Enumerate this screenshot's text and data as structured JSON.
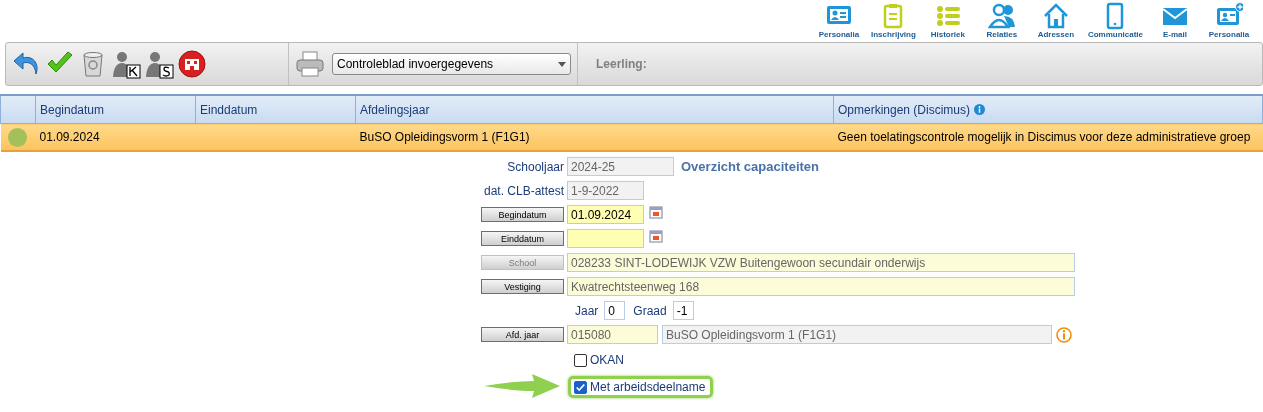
{
  "nav": [
    {
      "label": "Personalia"
    },
    {
      "label": "Inschrijving"
    },
    {
      "label": "Historiek"
    },
    {
      "label": "Relaties"
    },
    {
      "label": "Adressen"
    },
    {
      "label": "Communicatie"
    },
    {
      "label": "E-mail"
    },
    {
      "label": "Personalia"
    }
  ],
  "toolbar": {
    "report": "Controleblad invoergegevens",
    "student_label": "Leerling:"
  },
  "table": {
    "columns": [
      "Begindatum",
      "Einddatum",
      "Afdelingsjaar",
      "Opmerkingen (Discimus)"
    ],
    "rows": [
      {
        "color": "#a3c05a",
        "selected": true,
        "cells": [
          "01.09.2024",
          "",
          "BuSO Opleidingsvorm 1 (F1G1)",
          "Geen toelatingscontrole mogelijk in Discimus voor deze administratieve groep"
        ]
      }
    ]
  },
  "form": {
    "schooljaar": {
      "label": "Schooljaar",
      "value": "2024-25",
      "link": "Overzicht capaciteiten"
    },
    "clb": {
      "label": "dat. CLB-attest",
      "value": "1-9-2022"
    },
    "begindatum": {
      "button": "Begindatum",
      "value": "01.09.2024"
    },
    "einddatum": {
      "button": "Einddatum"
    },
    "school": {
      "button": "School",
      "disabled": true,
      "value": "028233 SINT-LODEWIJK VZW Buitengewoon secundair onderwijs"
    },
    "vestiging": {
      "button": "Vestiging",
      "disabled": false,
      "value": "Kwatrechtsteenweg 168"
    },
    "jaar": {
      "label": "Jaar",
      "value": "0"
    },
    "graad": {
      "label": "Graad",
      "value": "-1"
    },
    "afd": {
      "button": "Afd. jaar",
      "code": "015080",
      "name": "BuSO Opleidingsvorm 1 (F1G1)"
    },
    "checks": [
      {
        "label": "OKAN",
        "checked": false,
        "highlighted": false
      },
      {
        "label": "Met arbeidsdeelname",
        "checked": true,
        "highlighted": true
      }
    ]
  }
}
